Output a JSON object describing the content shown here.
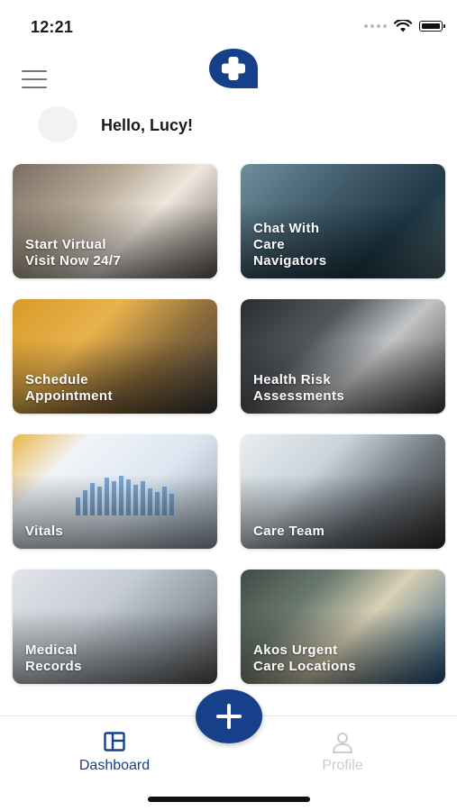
{
  "status_bar": {
    "time": "12:21"
  },
  "header": {
    "menu_icon": "hamburger-menu-icon",
    "logo_icon": "medical-cross-logo-icon",
    "greeting": "Hello, Lucy!"
  },
  "tiles": [
    {
      "label": "Start Virtual\nVisit Now 24/7"
    },
    {
      "label": "Chat With\nCare\nNavigators"
    },
    {
      "label": "Schedule\nAppointment"
    },
    {
      "label": "Health Risk\nAssessments"
    },
    {
      "label": "Vitals"
    },
    {
      "label": "Care Team"
    },
    {
      "label": "Medical\nRecords"
    },
    {
      "label": "Akos Urgent\nCare Locations"
    }
  ],
  "bottom_nav": {
    "dashboard_label": "Dashboard",
    "profile_label": "Profile",
    "fab_icon": "plus-icon"
  },
  "colors": {
    "brand": "#17408a",
    "inactive": "#c9cdd2"
  }
}
